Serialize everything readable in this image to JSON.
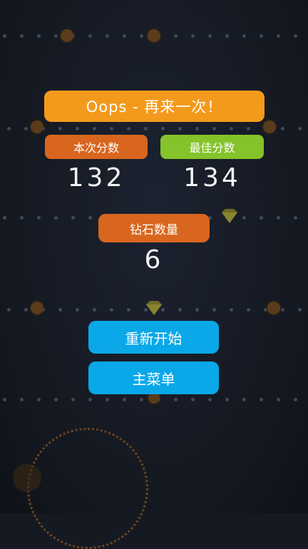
{
  "dialog": {
    "title": "Oops - 再来一次！",
    "current_score_label": "本次分数",
    "best_score_label": "最佳分数",
    "current_score": "132",
    "best_score": "134",
    "gems_label": "钻石数量",
    "gems": "6"
  },
  "buttons": {
    "restart": "重新开始",
    "main_menu": "主菜单"
  },
  "colors": {
    "title_bg": "#f39a1c",
    "current_label_bg": "#d9661e",
    "best_label_bg": "#84c32a",
    "button_bg": "#0aa8e8",
    "background": "#151a22"
  }
}
